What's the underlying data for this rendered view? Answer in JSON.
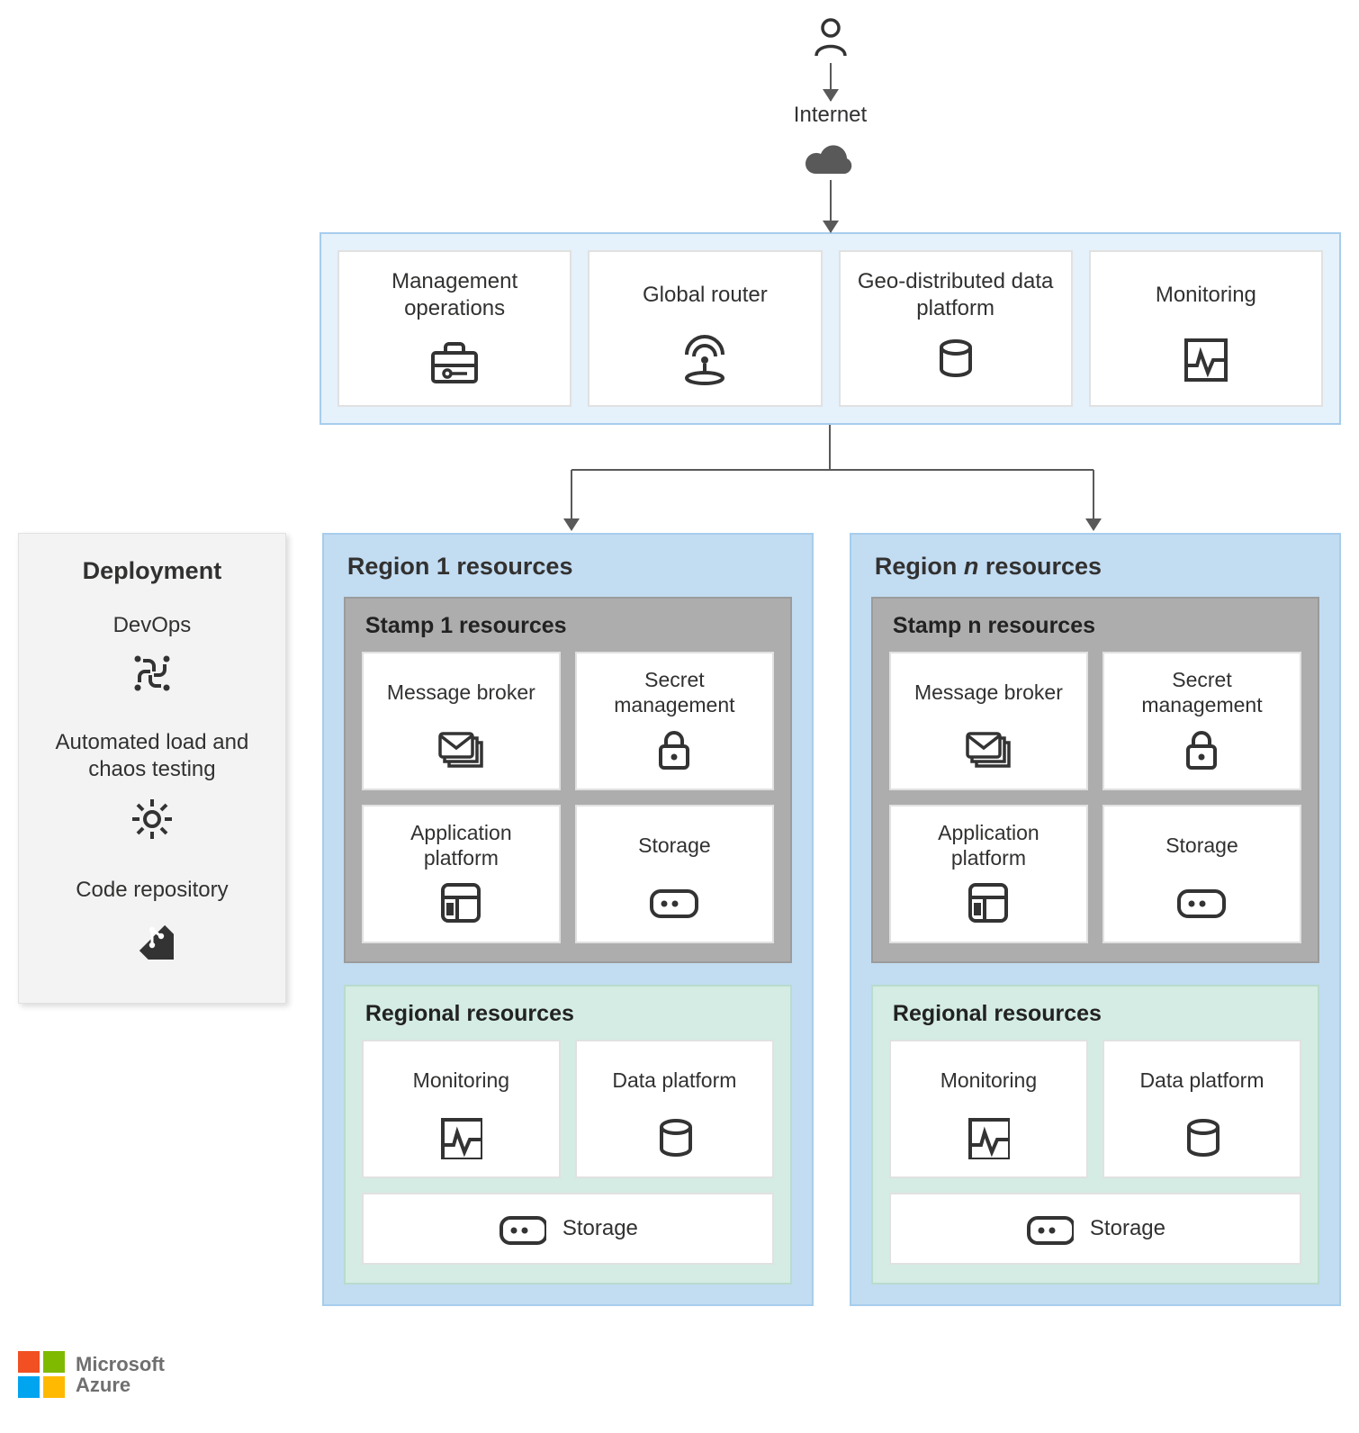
{
  "top": {
    "internet_label": "Internet"
  },
  "global": {
    "cards": [
      {
        "label": "Management operations",
        "icon": "toolbox"
      },
      {
        "label": "Global router",
        "icon": "router"
      },
      {
        "label": "Geo-distributed data platform",
        "icon": "database"
      },
      {
        "label": "Monitoring",
        "icon": "monitoring"
      }
    ]
  },
  "deployment": {
    "title": "Deployment",
    "items": [
      {
        "label": "DevOps",
        "icon": "devops"
      },
      {
        "label": "Automated load and chaos testing",
        "icon": "gear"
      },
      {
        "label": "Code repository",
        "icon": "git"
      }
    ]
  },
  "regions": [
    {
      "title_prefix": "Region ",
      "title_num": "1",
      "title_suffix": " resources",
      "num_italic": false,
      "stamp": {
        "title": "Stamp 1 resources",
        "cards": [
          {
            "label": "Message broker",
            "icon": "envelope-stack"
          },
          {
            "label": "Secret management",
            "icon": "lock"
          },
          {
            "label": "Application platform",
            "icon": "app-window"
          },
          {
            "label": "Storage",
            "icon": "storage"
          }
        ]
      },
      "regional": {
        "title": "Regional resources",
        "cards": [
          {
            "label": "Monitoring",
            "icon": "monitoring"
          },
          {
            "label": "Data platform",
            "icon": "database"
          }
        ],
        "storage_label": "Storage"
      }
    },
    {
      "title_prefix": "Region ",
      "title_num": "n",
      "title_suffix": " resources",
      "num_italic": true,
      "stamp": {
        "title": "Stamp n resources",
        "cards": [
          {
            "label": "Message broker",
            "icon": "envelope-stack"
          },
          {
            "label": "Secret management",
            "icon": "lock"
          },
          {
            "label": "Application platform",
            "icon": "app-window"
          },
          {
            "label": "Storage",
            "icon": "storage"
          }
        ]
      },
      "regional": {
        "title": "Regional resources",
        "cards": [
          {
            "label": "Monitoring",
            "icon": "monitoring"
          },
          {
            "label": "Data platform",
            "icon": "database"
          }
        ],
        "storage_label": "Storage"
      }
    }
  ],
  "branding": {
    "line1": "Microsoft",
    "line2": "Azure",
    "colors": [
      "#f25022",
      "#7fba00",
      "#00a4ef",
      "#ffb900"
    ]
  }
}
